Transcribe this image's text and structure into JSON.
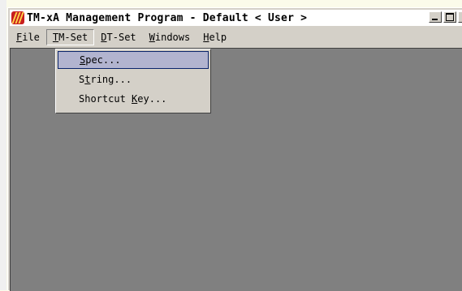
{
  "window": {
    "title": "TM-xA Management Program - Default < User >",
    "buttons": {
      "minimize": "_",
      "maximize": "□",
      "close": "×"
    }
  },
  "menubar": {
    "items": [
      {
        "pre": "",
        "acc": "F",
        "post": "ile"
      },
      {
        "pre": "",
        "acc": "T",
        "post": "M-Set"
      },
      {
        "pre": "",
        "acc": "D",
        "post": "T-Set"
      },
      {
        "pre": "",
        "acc": "W",
        "post": "indows"
      },
      {
        "pre": "",
        "acc": "H",
        "post": "elp"
      }
    ]
  },
  "dropdown": {
    "items": [
      {
        "pre": "",
        "acc": "S",
        "post": "pec..."
      },
      {
        "pre": "S",
        "acc": "t",
        "post": "ring..."
      },
      {
        "pre": "Shortcut ",
        "acc": "K",
        "post": "ey..."
      }
    ]
  }
}
